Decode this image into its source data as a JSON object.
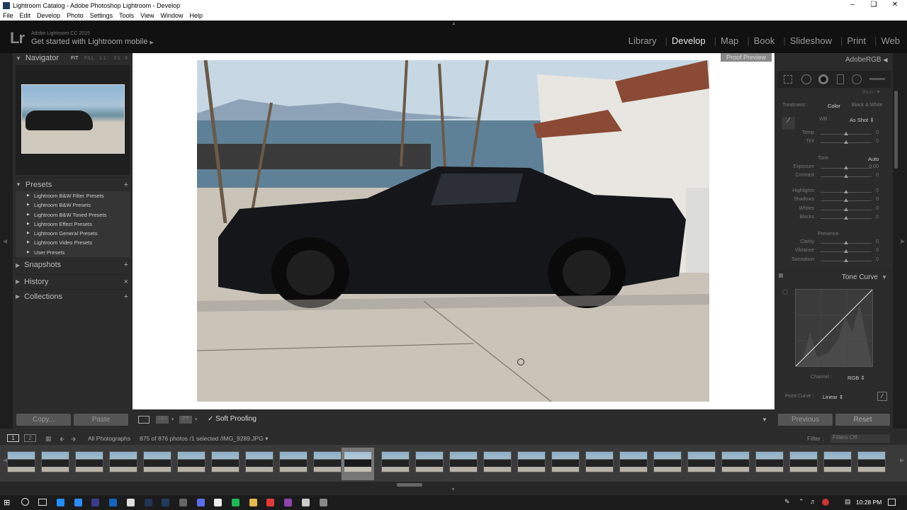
{
  "window": {
    "title": "Lightroom Catalog - Adobe Photoshop Lightroom - Develop"
  },
  "menu": [
    "File",
    "Edit",
    "Develop",
    "Photo",
    "Settings",
    "Tools",
    "View",
    "Window",
    "Help"
  ],
  "identity": {
    "logo": "Lr",
    "version": "Adobe Lightroom CC 2015",
    "mobile": "Get started with Lightroom mobile"
  },
  "modules": [
    "Library",
    "Develop",
    "Map",
    "Book",
    "Slideshow",
    "Print",
    "Web"
  ],
  "navigator": {
    "title": "Navigator",
    "zoom": [
      "FIT",
      "FILL",
      "1:1",
      "3:1"
    ]
  },
  "presets": {
    "title": "Presets",
    "items": [
      "Lightroom B&W Filter Presets",
      "Lightroom B&W Presets",
      "Lightroom B&W Toned Presets",
      "Lightroom Effect Presets",
      "Lightroom General Presets",
      "Lightroom Video Presets",
      "User Presets"
    ]
  },
  "snapshots": "Snapshots",
  "history": "History",
  "collections": "Collections",
  "copy_label": "Copy...",
  "paste_label": "Paste",
  "proof_preview": "Proof Preview",
  "soft_proofing": "Soft Proofing",
  "right": {
    "profile": "AdobeRGB",
    "basic_label": "Basic",
    "treatment": "Treatment :",
    "color": "Color",
    "bw": "Black & White",
    "wb": "WB :",
    "wb_value": "As Shot",
    "tone": "Tone",
    "auto": "Auto",
    "presence": "Presence",
    "tone_curve": "Tone Curve",
    "channel": "Channel :",
    "channel_value": "RGB",
    "point_curve": "Point Curve :",
    "point_curve_value": "Linear",
    "sliders": [
      {
        "name": "Temp",
        "value": "0",
        "pos": 0.5
      },
      {
        "name": "Tint",
        "value": "0",
        "pos": 0.5
      },
      {
        "name": "Exposure",
        "value": "0.00",
        "pos": 0.5
      },
      {
        "name": "Contrast",
        "value": "0",
        "pos": 0.5
      },
      {
        "name": "Highlights",
        "value": "0",
        "pos": 0.5
      },
      {
        "name": "Shadows",
        "value": "0",
        "pos": 0.5
      },
      {
        "name": "Whites",
        "value": "0",
        "pos": 0.5
      },
      {
        "name": "Blacks",
        "value": "0",
        "pos": 0.5
      },
      {
        "name": "Clarity",
        "value": "0",
        "pos": 0.5
      },
      {
        "name": "Vibrance",
        "value": "0",
        "pos": 0.5
      },
      {
        "name": "Saturation",
        "value": "0",
        "pos": 0.5
      }
    ]
  },
  "previous": "Previous",
  "reset": "Reset",
  "filmstrip": {
    "page1": "1",
    "page2": "2",
    "source": "All Photographs",
    "count": "875 of 876 photos /1 selected /IMG_9289.JPG",
    "filter_label": "Filter :",
    "filter_value": "Filters Off"
  },
  "clock": "10:28 PM"
}
